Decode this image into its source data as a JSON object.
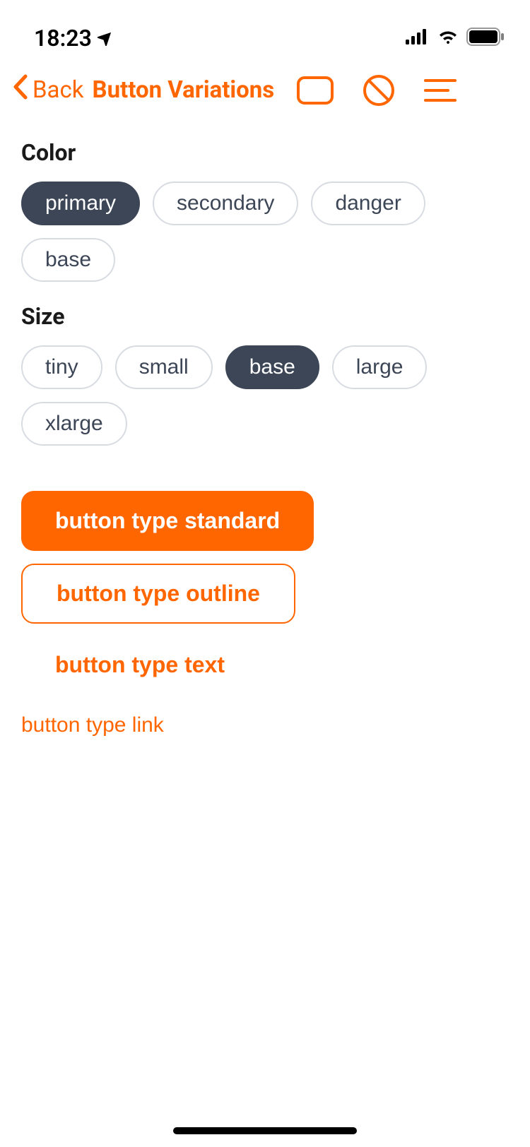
{
  "statusBar": {
    "time": "18:23"
  },
  "nav": {
    "backLabel": "Back",
    "title": "Button Variations"
  },
  "sections": {
    "color": {
      "label": "Color",
      "options": {
        "primary": "primary",
        "secondary": "secondary",
        "danger": "danger",
        "base": "base"
      },
      "selected": "primary"
    },
    "size": {
      "label": "Size",
      "options": {
        "tiny": "tiny",
        "small": "small",
        "base": "base",
        "large": "large",
        "xlarge": "xlarge"
      },
      "selected": "base"
    }
  },
  "buttons": {
    "standard": "button type standard",
    "outline": "button type outline",
    "text": "button type text",
    "link": "button type link"
  },
  "colors": {
    "accent": "#FF6600",
    "pillSelected": "#3c4656"
  }
}
